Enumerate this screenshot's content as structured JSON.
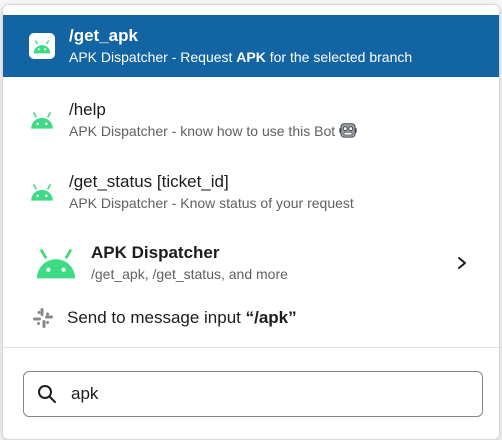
{
  "results": [
    {
      "command": "/get_apk",
      "desc_before": "APK Dispatcher - Request ",
      "desc_bold": "APK",
      "desc_after": " for the selected branch",
      "selected": true,
      "icon": "android-icon"
    },
    {
      "command": "/help",
      "desc": "APK Dispatcher - know how to use this Bot",
      "emoji": "robot-face-icon",
      "icon": "android-icon"
    },
    {
      "command": "/get_status [ticket_id]",
      "desc": "APK Dispatcher - Know status of your request",
      "icon": "android-icon"
    }
  ],
  "app": {
    "name": "APK Dispatcher",
    "commands": "/get_apk, /get_status, and more",
    "icon": "android-icon",
    "action_icon": "chevron-right-icon"
  },
  "send": {
    "before": "Send to message input ",
    "quoted": "“/apk”",
    "icon": "slack-logo-icon"
  },
  "search": {
    "value": "apk",
    "icon": "search-icon"
  },
  "colors": {
    "selected_bg": "#1264a3",
    "android_green": "#3ddc84",
    "muted_text": "#616061"
  }
}
